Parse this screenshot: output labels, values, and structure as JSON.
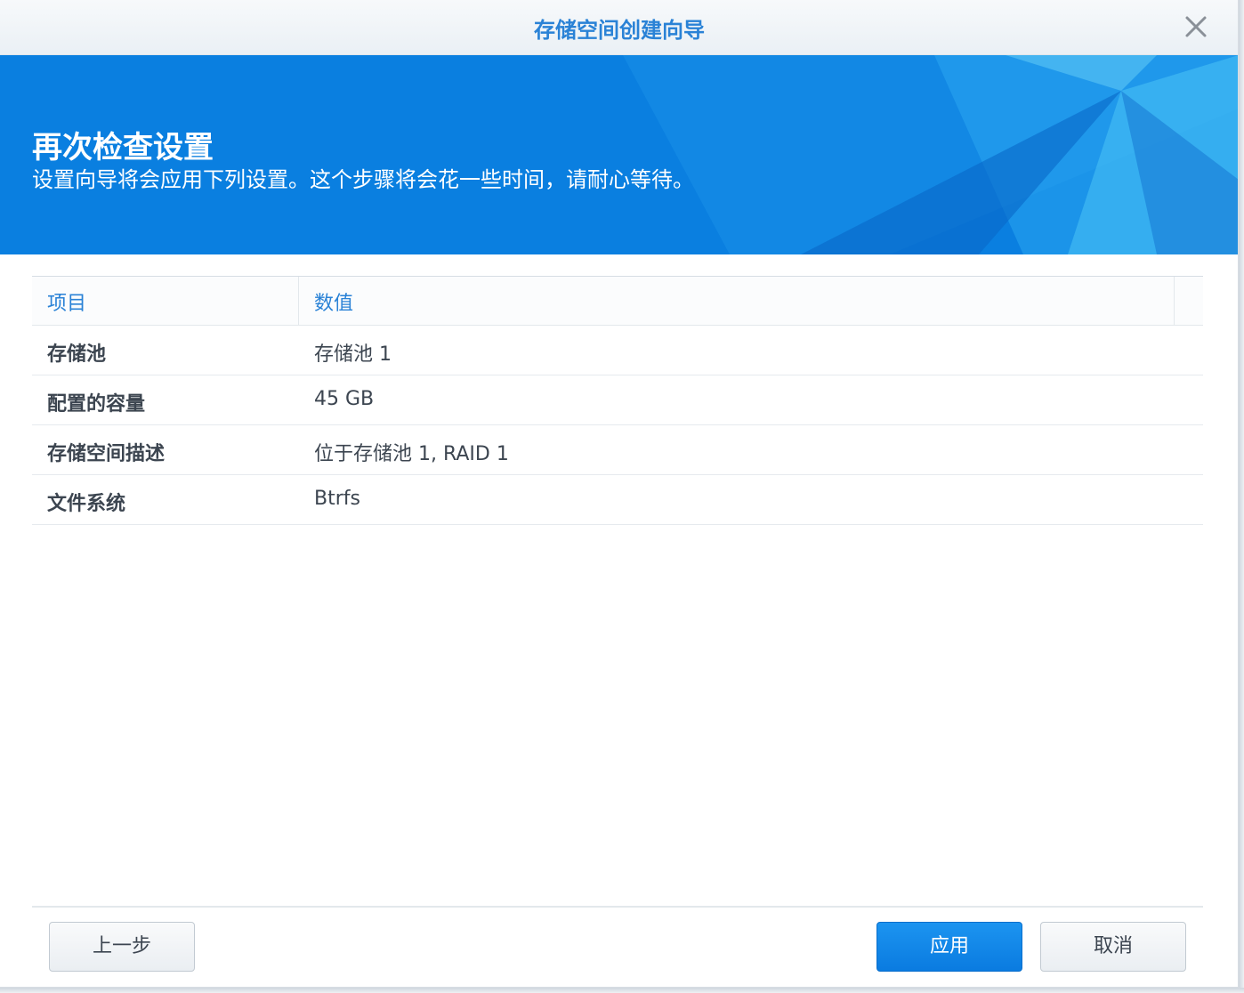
{
  "window": {
    "title": "存储空间创建向导"
  },
  "banner": {
    "heading": "再次检查设置",
    "subtitle": "设置向导将会应用下列设置。这个步骤将会花一些时间，请耐心等待。"
  },
  "table": {
    "headers": [
      "项目",
      "数值"
    ],
    "rows": [
      {
        "key": "存储池",
        "value": "存储池 1"
      },
      {
        "key": "配置的容量",
        "value": "45 GB"
      },
      {
        "key": "存储空间描述",
        "value": "位于存储池 1, RAID 1"
      },
      {
        "key": "文件系统",
        "value": "Btrfs"
      }
    ]
  },
  "footer": {
    "prev_label": "上一步",
    "apply_label": "应用",
    "cancel_label": "取消"
  },
  "icons": {
    "close": "close-icon"
  },
  "colors": {
    "accent": "#2a82d6",
    "banner": "#0a7fe0",
    "primary_button": "#0a7be0"
  }
}
